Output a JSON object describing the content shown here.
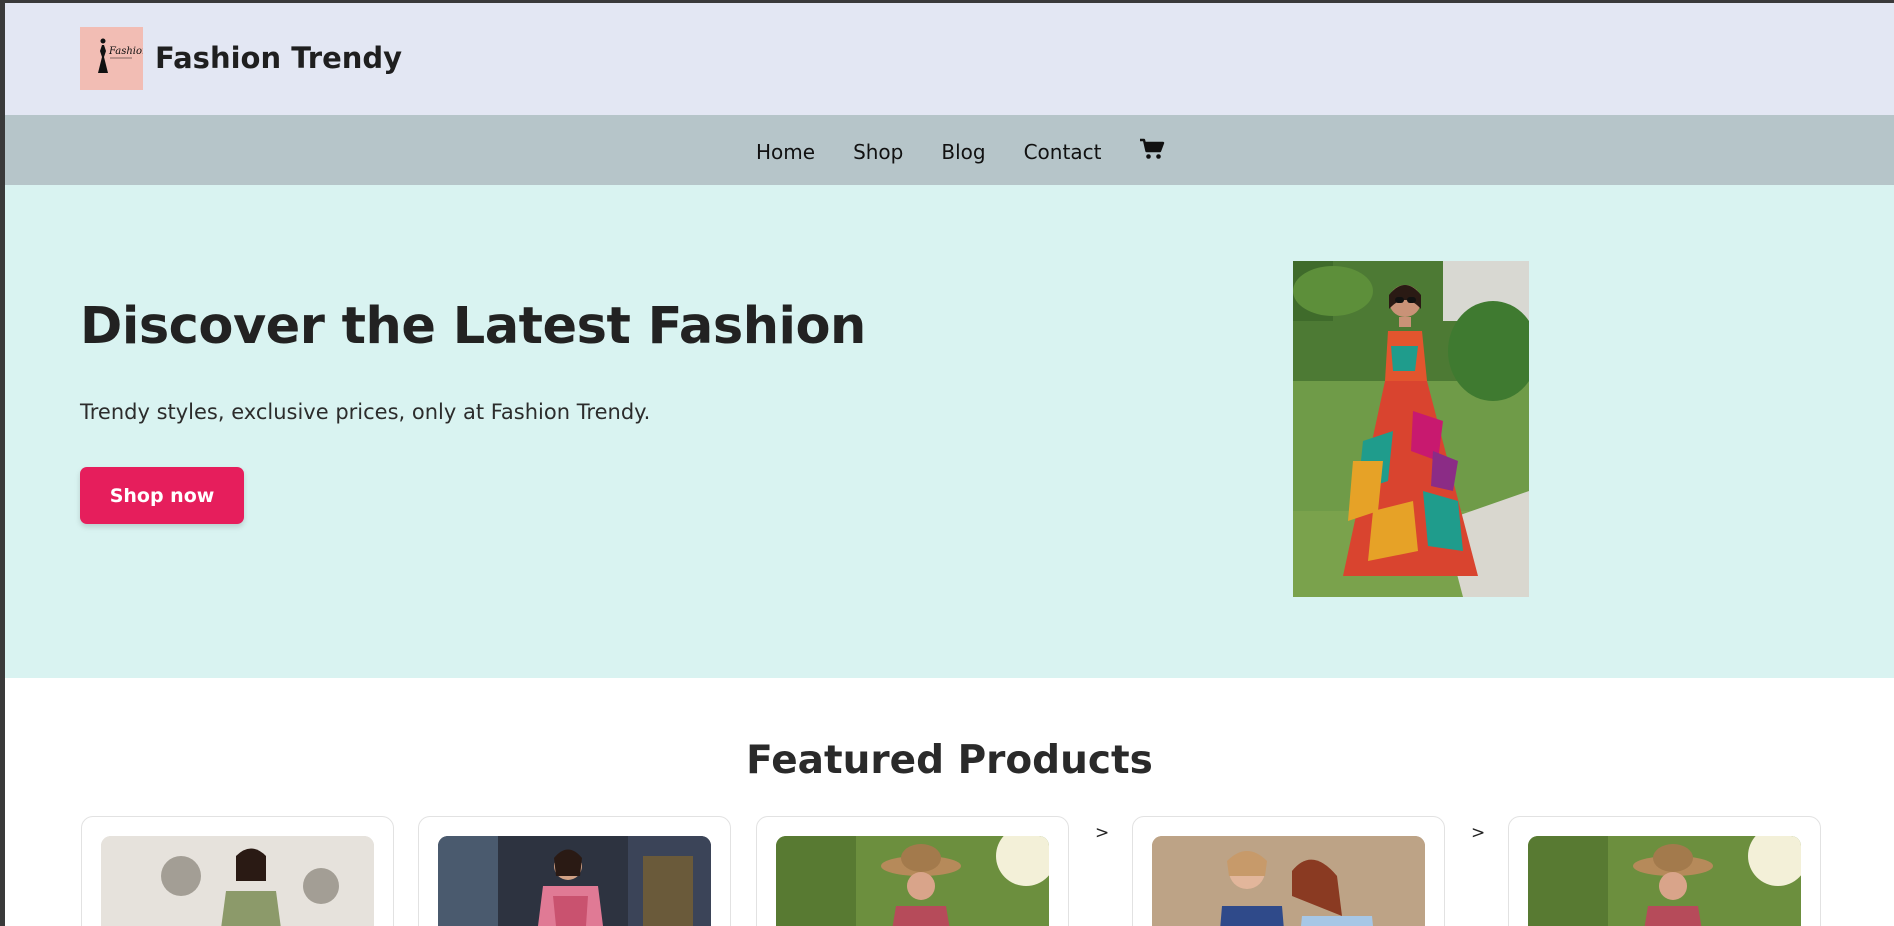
{
  "header": {
    "site_title": "Fashion Trendy",
    "logo_text": "Fashion"
  },
  "nav": {
    "items": [
      {
        "label": "Home"
      },
      {
        "label": "Shop"
      },
      {
        "label": "Blog"
      },
      {
        "label": "Contact"
      }
    ],
    "cart_icon": "shopping-cart-icon"
  },
  "hero": {
    "title": "Discover the Latest Fashion",
    "subtitle": "Trendy styles, exclusive prices, only at Fashion Trendy.",
    "button_label": "Shop now"
  },
  "featured": {
    "title": "Featured Products",
    "separator": ">"
  },
  "colors": {
    "header_bg": "#e3e7f3",
    "nav_bg": "#b6c5c9",
    "hero_bg": "#d9f3f1",
    "accent": "#e61e5c",
    "logo_bg": "#f2bdb4"
  }
}
